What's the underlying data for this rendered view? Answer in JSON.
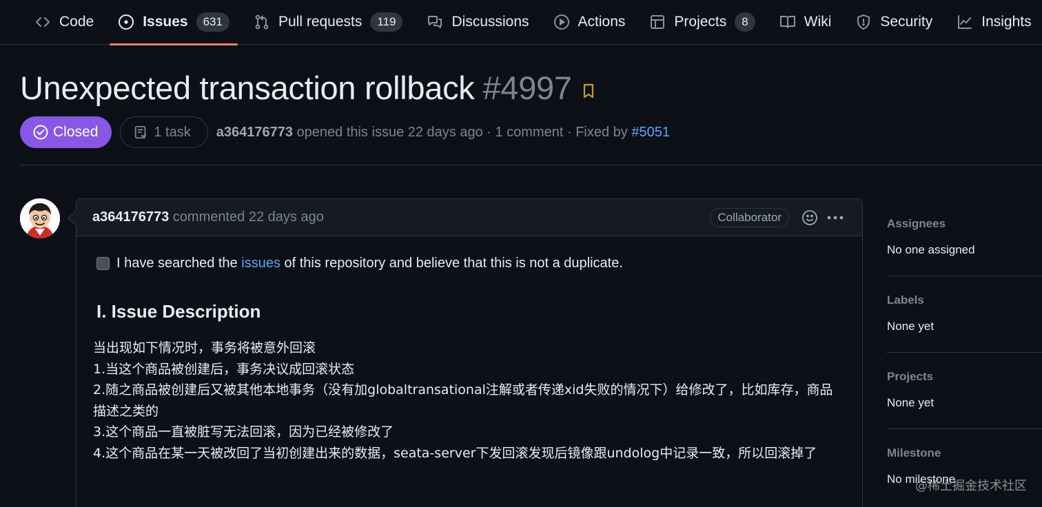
{
  "nav": {
    "tabs": [
      {
        "label": "Code",
        "icon": "code-icon",
        "counter": null,
        "selected": false
      },
      {
        "label": "Issues",
        "icon": "issue-opened-icon",
        "counter": "631",
        "selected": true
      },
      {
        "label": "Pull requests",
        "icon": "git-pull-request-icon",
        "counter": "119",
        "selected": false
      },
      {
        "label": "Discussions",
        "icon": "discussions-icon",
        "counter": null,
        "selected": false
      },
      {
        "label": "Actions",
        "icon": "play-icon",
        "counter": null,
        "selected": false
      },
      {
        "label": "Projects",
        "icon": "table-icon",
        "counter": "8",
        "selected": false
      },
      {
        "label": "Wiki",
        "icon": "book-icon",
        "counter": null,
        "selected": false
      },
      {
        "label": "Security",
        "icon": "shield-icon",
        "counter": null,
        "selected": false
      },
      {
        "label": "Insights",
        "icon": "graph-icon",
        "counter": null,
        "selected": false
      }
    ]
  },
  "issue": {
    "title": "Unexpected transaction rollback",
    "number": "#4997",
    "state": "Closed",
    "state_color": "#8957e5",
    "tasks": "1 task",
    "author": "a364176773",
    "opened_text": " opened this issue 22 days ago · 1 comment · Fixed by ",
    "fixed_by": "#5051"
  },
  "comment": {
    "author": "a364176773",
    "time_text": " commented 22 days ago",
    "role_badge": "Collaborator",
    "checkbox_before": "I have searched the ",
    "checkbox_link": "issues",
    "checkbox_after": " of this repository and believe that this is not a duplicate.",
    "heading": "I. Issue Description",
    "lines": [
      "当出现如下情况时，事务将被意外回滚",
      "1.当这个商品被创建后，事务决议成回滚状态",
      "2.随之商品被创建后又被其他本地事务（没有加globaltransational注解或者传递xid失败的情况下）给修改了，比如库存，商品描述之类的",
      "3.这个商品一直被脏写无法回滚，因为已经被修改了",
      "4.这个商品在某一天被改回了当初创建出来的数据，seata-server下发回滚发现后镜像跟undolog中记录一致，所以回滚掉了"
    ]
  },
  "sidebar": {
    "sections": [
      {
        "heading": "Assignees",
        "value": "No one assigned"
      },
      {
        "heading": "Labels",
        "value": "None yet"
      },
      {
        "heading": "Projects",
        "value": "None yet"
      },
      {
        "heading": "Milestone",
        "value": "No milestone"
      }
    ]
  },
  "watermark": "@稀土掘金技术社区",
  "colors": {
    "accent_underline": "#f78166",
    "link": "#58a6ff",
    "background": "#0d1117"
  }
}
